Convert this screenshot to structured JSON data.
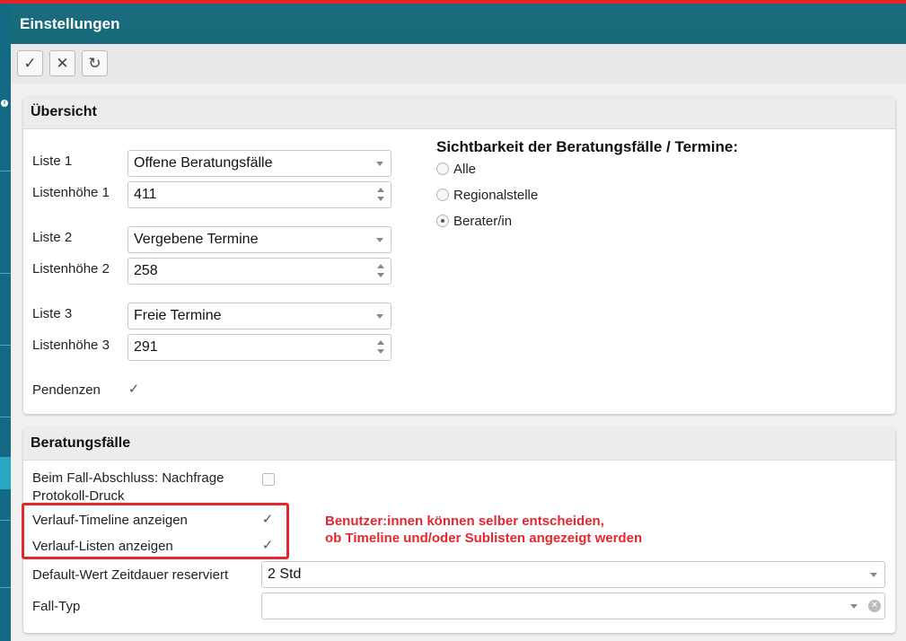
{
  "window": {
    "title": "Einstellungen"
  },
  "colors": {
    "accent_red": "#e8202a",
    "header_teal": "#166a7a",
    "sidebar": "#146a85",
    "annotation": "#e3262f"
  },
  "toolbar": {
    "save_icon": "check-icon",
    "save_glyph": "✓",
    "cancel_icon": "close-icon",
    "cancel_glyph": "✕",
    "refresh_icon": "refresh-icon",
    "refresh_glyph": "↻"
  },
  "uebersicht": {
    "title": "Übersicht",
    "liste1_label": "Liste 1",
    "liste1_value": "Offene Beratungsfälle",
    "hoehe1_label": "Listenhöhe 1",
    "hoehe1_value": "411",
    "liste2_label": "Liste 2",
    "liste2_value": "Vergebene Termine",
    "hoehe2_label": "Listenhöhe 2",
    "hoehe2_value": "258",
    "liste3_label": "Liste 3",
    "liste3_value": "Freie Termine",
    "hoehe3_label": "Listenhöhe 3",
    "hoehe3_value": "291",
    "pendenzen_label": "Pendenzen",
    "pendenzen_checked": true,
    "check_glyph": "✓",
    "sichtbarkeit_title": "Sichtbarkeit der Beratungsfälle / Termine:",
    "sichtbarkeit_options": [
      "Alle",
      "Regionalstelle",
      "Berater/in"
    ],
    "sichtbarkeit_selected": "Berater/in"
  },
  "beratungsfaelle": {
    "title": "Beratungsfälle",
    "abschluss_label_line1": "Beim Fall-Abschluss: Nachfrage",
    "abschluss_label_line2": "Protokoll-Druck",
    "abschluss_checked": false,
    "timeline_label": "Verlauf-Timeline anzeigen",
    "timeline_checked": true,
    "listen_label": "Verlauf-Listen anzeigen",
    "listen_checked": true,
    "zeitdauer_label": "Default-Wert Zeitdauer reserviert",
    "zeitdauer_value": "2 Std",
    "falltyp_label": "Fall-Typ",
    "falltyp_value": ""
  },
  "annotation": {
    "line1": "Benutzer:innen können selber entscheiden,",
    "line2": "ob Timeline und/oder Sublisten angezeigt werden"
  }
}
